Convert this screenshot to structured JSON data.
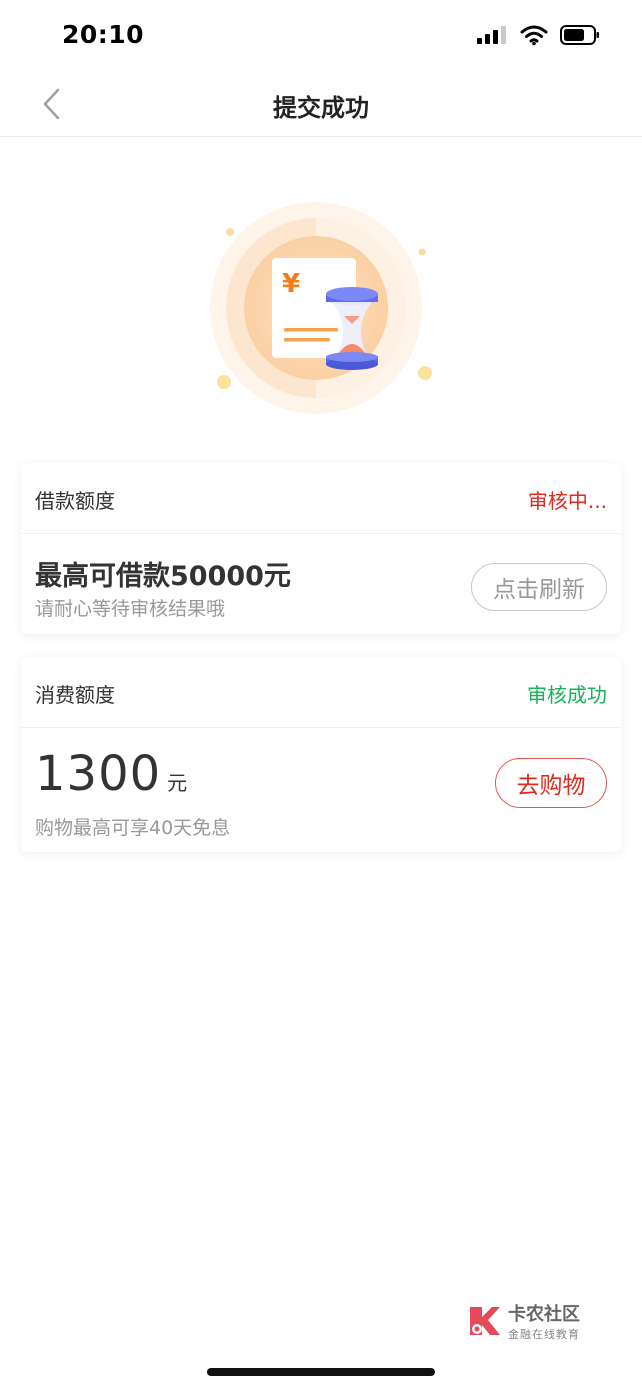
{
  "status_bar": {
    "time": "20:10"
  },
  "nav": {
    "title": "提交成功"
  },
  "loan_card": {
    "title": "借款额度",
    "status": "审核中...",
    "amount_text": "最高可借款50000元",
    "subtitle": "请耐心等待审核结果哦",
    "button_label": "点击刷新"
  },
  "consume_card": {
    "title": "消费额度",
    "status": "审核成功",
    "amount": "1300",
    "unit": "元",
    "subtitle": "购物最高可享40天免息",
    "button_label": "去购物"
  },
  "watermark": {
    "title": "卡农社区",
    "subtitle": "金融在线教育"
  },
  "colors": {
    "red": "#e02b20",
    "green": "#1bb35a",
    "orange": "#f59a3c",
    "blue": "#5b6cf0"
  }
}
